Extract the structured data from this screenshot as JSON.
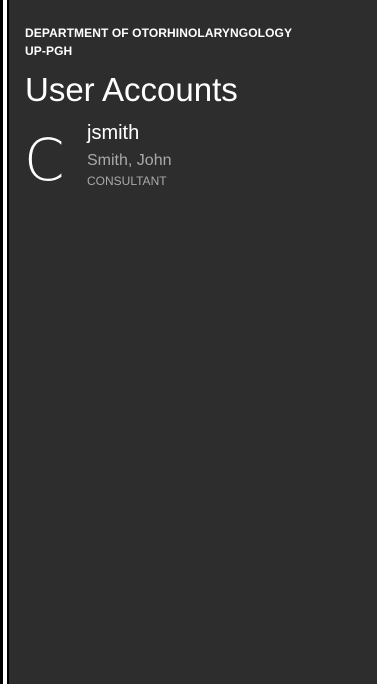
{
  "header": {
    "department_line1": "DEPARTMENT OF OTORHINOLARYNGOLOGY",
    "department_line2": "UP-PGH",
    "title": "User Accounts"
  },
  "users": [
    {
      "initial": "C",
      "username": "jsmith",
      "full_name": "Smith, John",
      "role": "CONSULTANT"
    }
  ],
  "colors": {
    "background": "#2d2d2d",
    "primary_text": "#ffffff",
    "secondary_text": "#a9a9a9"
  }
}
